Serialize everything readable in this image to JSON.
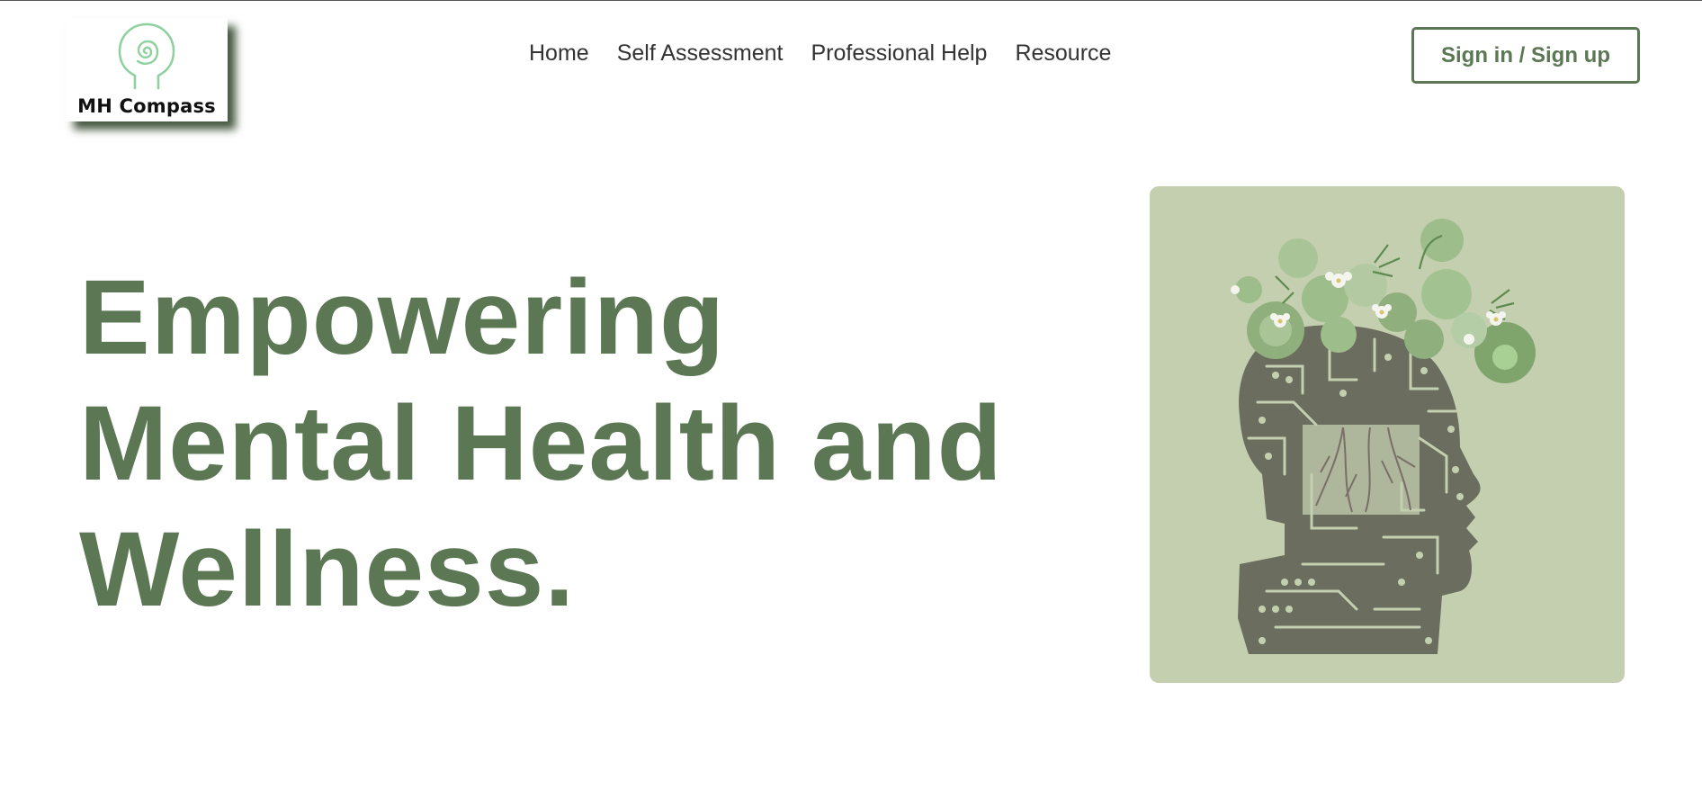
{
  "brand": {
    "name": "MH Compass",
    "logo_icon": "spiral-head-icon"
  },
  "nav": {
    "items": [
      {
        "label": "Home"
      },
      {
        "label": "Self Assessment"
      },
      {
        "label": "Professional Help"
      },
      {
        "label": "Resource"
      }
    ]
  },
  "auth": {
    "signin_label": "Sign in / Sign up"
  },
  "hero": {
    "title_lines": [
      "Empowering",
      "Mental Health and",
      "Wellness."
    ],
    "image_icon": "circuit-head-with-flowers-illustration"
  },
  "colors": {
    "brand_green": "#5b7753",
    "image_background": "#c4cfb0",
    "circuit_gray": "#6b6e5e",
    "logo_mint": "#8fd19e"
  }
}
